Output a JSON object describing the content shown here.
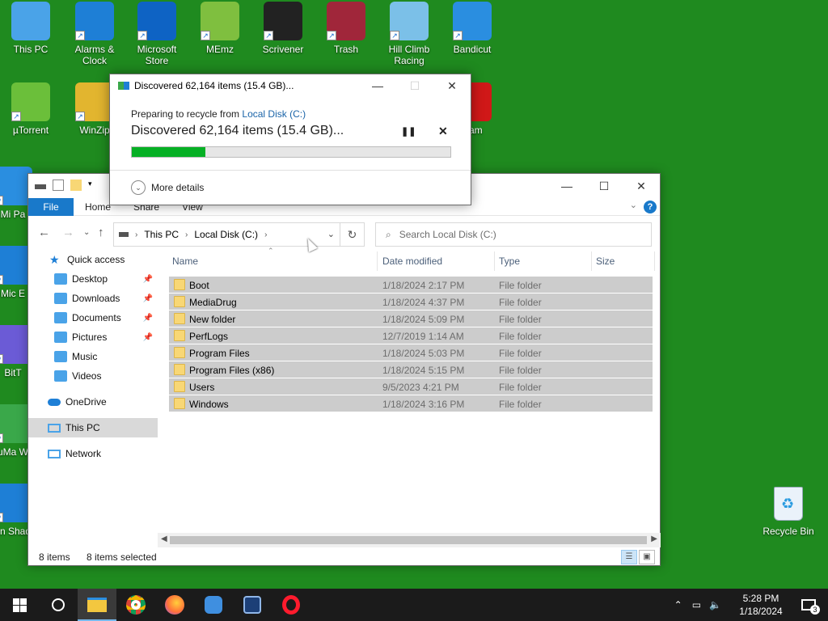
{
  "desktop": {
    "icons": [
      {
        "label": "This PC",
        "icon": "monitor-icon",
        "color": "#4aa3e8"
      },
      {
        "label": "Alarms & Clock",
        "icon": "alarm-clock-icon",
        "color": "#1e7fd6"
      },
      {
        "label": "Microsoft Store",
        "icon": "store-bag-icon",
        "color": "#0e63c4"
      },
      {
        "label": "MEmz",
        "icon": "memz-icon",
        "color": "#7fbf3f"
      },
      {
        "label": "Scrivener",
        "icon": "scrivener-icon",
        "color": "#222222"
      },
      {
        "label": "Trash",
        "icon": "winrar-books-icon",
        "color": "#a0263a"
      },
      {
        "label": "Hill Climb Racing",
        "icon": "hill-climb-car-icon",
        "color": "#7bc0e8"
      },
      {
        "label": "Bandicut",
        "icon": "film-strip-icon",
        "color": "#2a8ee0"
      },
      {
        "label": "µTorrent",
        "icon": "utorrent-icon",
        "color": "#6bbf3a"
      },
      {
        "label": "WinZip",
        "icon": "winzip-icon",
        "color": "#e2b52f"
      },
      {
        "label": "icam",
        "icon": "record-camera-icon",
        "color": "#d01818"
      },
      {
        "label": "Mi Pa",
        "icon": "app-icon",
        "color": "#2a8ee0"
      },
      {
        "label": "Mic E",
        "icon": "edge-icon",
        "color": "#1e7fd6"
      },
      {
        "label": "BitT",
        "icon": "bittorrent-icon",
        "color": "#6b5bd6"
      },
      {
        "label": "uMa W",
        "icon": "app-icon",
        "color": "#3aa84a"
      },
      {
        "label": "Min Shado",
        "icon": "app-icon",
        "color": "#1e7fd6"
      }
    ],
    "recycle_bin": "Recycle Bin"
  },
  "dialog": {
    "title": "Discovered 62,164 items (15.4 GB)...",
    "subtitle_prefix": "Preparing to recycle from ",
    "subtitle_link": "Local Disk (C:)",
    "main_text": "Discovered 62,164 items (15.4 GB)...",
    "progress_fraction": 0.23,
    "more_details": "More details",
    "pause_glyph": "❚❚",
    "cancel_glyph": "✕"
  },
  "explorer": {
    "ribbon": {
      "file": "File",
      "tabs": [
        "Home",
        "Share",
        "View"
      ]
    },
    "breadcrumb": [
      "This PC",
      "Local Disk (C:)"
    ],
    "search_placeholder": "Search Local Disk (C:)",
    "nav": {
      "quick_access": "Quick access",
      "pinned": [
        {
          "label": "Desktop",
          "icon": "desktop-folder-icon",
          "pinned": true
        },
        {
          "label": "Downloads",
          "icon": "download-arrow-icon",
          "pinned": true
        },
        {
          "label": "Documents",
          "icon": "document-icon",
          "pinned": true
        },
        {
          "label": "Pictures",
          "icon": "pictures-icon",
          "pinned": true
        },
        {
          "label": "Music",
          "icon": "music-note-icon",
          "pinned": false
        },
        {
          "label": "Videos",
          "icon": "film-icon",
          "pinned": false
        }
      ],
      "onedrive": "OneDrive",
      "this_pc": "This PC",
      "network": "Network"
    },
    "columns": [
      "Name",
      "Date modified",
      "Type",
      "Size"
    ],
    "rows": [
      {
        "name": "Boot",
        "date": "1/18/2024 2:17 PM",
        "type": "File folder",
        "size": ""
      },
      {
        "name": "MediaDrug",
        "date": "1/18/2024 4:37 PM",
        "type": "File folder",
        "size": ""
      },
      {
        "name": "New folder",
        "date": "1/18/2024 5:09 PM",
        "type": "File folder",
        "size": ""
      },
      {
        "name": "PerfLogs",
        "date": "12/7/2019 1:14 AM",
        "type": "File folder",
        "size": ""
      },
      {
        "name": "Program Files",
        "date": "1/18/2024 5:03 PM",
        "type": "File folder",
        "size": ""
      },
      {
        "name": "Program Files (x86)",
        "date": "1/18/2024 5:15 PM",
        "type": "File folder",
        "size": ""
      },
      {
        "name": "Users",
        "date": "9/5/2023 4:21 PM",
        "type": "File folder",
        "size": ""
      },
      {
        "name": "Windows",
        "date": "1/18/2024 3:16 PM",
        "type": "File folder",
        "size": ""
      }
    ],
    "status": {
      "count": "8 items",
      "selected": "8 items selected"
    }
  },
  "taskbar": {
    "time": "5:28 PM",
    "date": "1/18/2024",
    "notification_count": "3"
  }
}
